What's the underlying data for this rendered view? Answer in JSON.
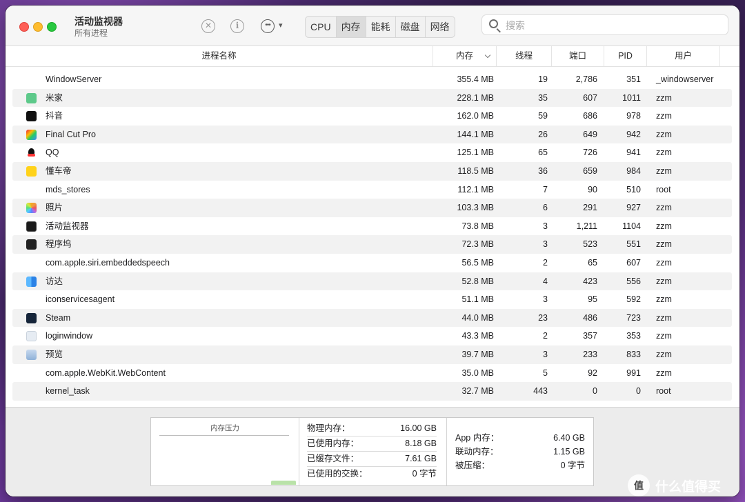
{
  "window": {
    "title": "活动监视器",
    "subtitle": "所有进程"
  },
  "toolbar": {
    "stop_icon": "x-circle-icon",
    "info_icon": "info-icon",
    "more_icon": "ellipsis-icon",
    "tabs": [
      {
        "label": "CPU"
      },
      {
        "label": "内存"
      },
      {
        "label": "能耗"
      },
      {
        "label": "磁盘"
      },
      {
        "label": "网络"
      }
    ],
    "active_tab": "内存"
  },
  "search": {
    "placeholder": "搜索"
  },
  "table": {
    "columns": {
      "name": "进程名称",
      "memory": "内存",
      "threads": "线程",
      "ports": "端口",
      "pid": "PID",
      "user": "用户"
    },
    "sorted_by": "内存",
    "rows": [
      {
        "name": "WindowServer",
        "icon": "none",
        "memory": "355.4 MB",
        "threads": "19",
        "ports": "2,786",
        "pid": "351",
        "user": "_windowserver"
      },
      {
        "name": "米家",
        "icon": "mijia-app-icon",
        "memory": "228.1 MB",
        "threads": "35",
        "ports": "607",
        "pid": "1011",
        "user": "zzm"
      },
      {
        "name": "抖音",
        "icon": "douyin-app-icon",
        "memory": "162.0 MB",
        "threads": "59",
        "ports": "686",
        "pid": "978",
        "user": "zzm"
      },
      {
        "name": "Final Cut Pro",
        "icon": "final-cut-pro-icon",
        "memory": "144.1 MB",
        "threads": "26",
        "ports": "649",
        "pid": "942",
        "user": "zzm"
      },
      {
        "name": "QQ",
        "icon": "qq-penguin-icon",
        "memory": "125.1 MB",
        "threads": "65",
        "ports": "726",
        "pid": "941",
        "user": "zzm"
      },
      {
        "name": "懂车帝",
        "icon": "dongchedi-app-icon",
        "memory": "118.5 MB",
        "threads": "36",
        "ports": "659",
        "pid": "984",
        "user": "zzm"
      },
      {
        "name": "mds_stores",
        "icon": "none",
        "memory": "112.1 MB",
        "threads": "7",
        "ports": "90",
        "pid": "510",
        "user": "root"
      },
      {
        "name": "照片",
        "icon": "photos-app-icon",
        "memory": "103.3 MB",
        "threads": "6",
        "ports": "291",
        "pid": "927",
        "user": "zzm"
      },
      {
        "name": "活动监视器",
        "icon": "activity-monitor-icon",
        "memory": "73.8 MB",
        "threads": "3",
        "ports": "1,211",
        "pid": "1104",
        "user": "zzm"
      },
      {
        "name": "程序坞",
        "icon": "dock-icon",
        "memory": "72.3 MB",
        "threads": "3",
        "ports": "523",
        "pid": "551",
        "user": "zzm"
      },
      {
        "name": "com.apple.siri.embeddedspeech",
        "icon": "none",
        "memory": "56.5 MB",
        "threads": "2",
        "ports": "65",
        "pid": "607",
        "user": "zzm"
      },
      {
        "name": "访达",
        "icon": "finder-icon",
        "memory": "52.8 MB",
        "threads": "4",
        "ports": "423",
        "pid": "556",
        "user": "zzm"
      },
      {
        "name": "iconservicesagent",
        "icon": "none",
        "memory": "51.1 MB",
        "threads": "3",
        "ports": "95",
        "pid": "592",
        "user": "zzm"
      },
      {
        "name": "Steam",
        "icon": "steam-icon",
        "memory": "44.0 MB",
        "threads": "23",
        "ports": "486",
        "pid": "723",
        "user": "zzm"
      },
      {
        "name": "loginwindow",
        "icon": "loginwindow-icon",
        "memory": "43.3 MB",
        "threads": "2",
        "ports": "357",
        "pid": "353",
        "user": "zzm"
      },
      {
        "name": "预览",
        "icon": "preview-icon",
        "memory": "39.7 MB",
        "threads": "3",
        "ports": "233",
        "pid": "833",
        "user": "zzm"
      },
      {
        "name": "com.apple.WebKit.WebContent",
        "icon": "none",
        "memory": "35.0 MB",
        "threads": "5",
        "ports": "92",
        "pid": "991",
        "user": "zzm"
      },
      {
        "name": "kernel_task",
        "icon": "none",
        "memory": "32.7 MB",
        "threads": "443",
        "ports": "0",
        "pid": "0",
        "user": "root"
      }
    ]
  },
  "memory_pressure": {
    "title": "内存压力",
    "color": "#b9e2a8"
  },
  "memory_stats": [
    {
      "label": "物理内存：",
      "value": "16.00 GB"
    },
    {
      "label": "已使用内存：",
      "value": "8.18 GB"
    },
    {
      "label": "已缓存文件：",
      "value": "7.61 GB"
    },
    {
      "label": "已使用的交换：",
      "value": "0 字节"
    }
  ],
  "memory_breakdown": [
    {
      "label": "App 内存：",
      "value": "6.40 GB"
    },
    {
      "label": "联动内存：",
      "value": "1.15 GB"
    },
    {
      "label": "被压缩：",
      "value": "0 字节"
    }
  ],
  "watermark": {
    "text": "什么值得买",
    "logo": "值"
  }
}
